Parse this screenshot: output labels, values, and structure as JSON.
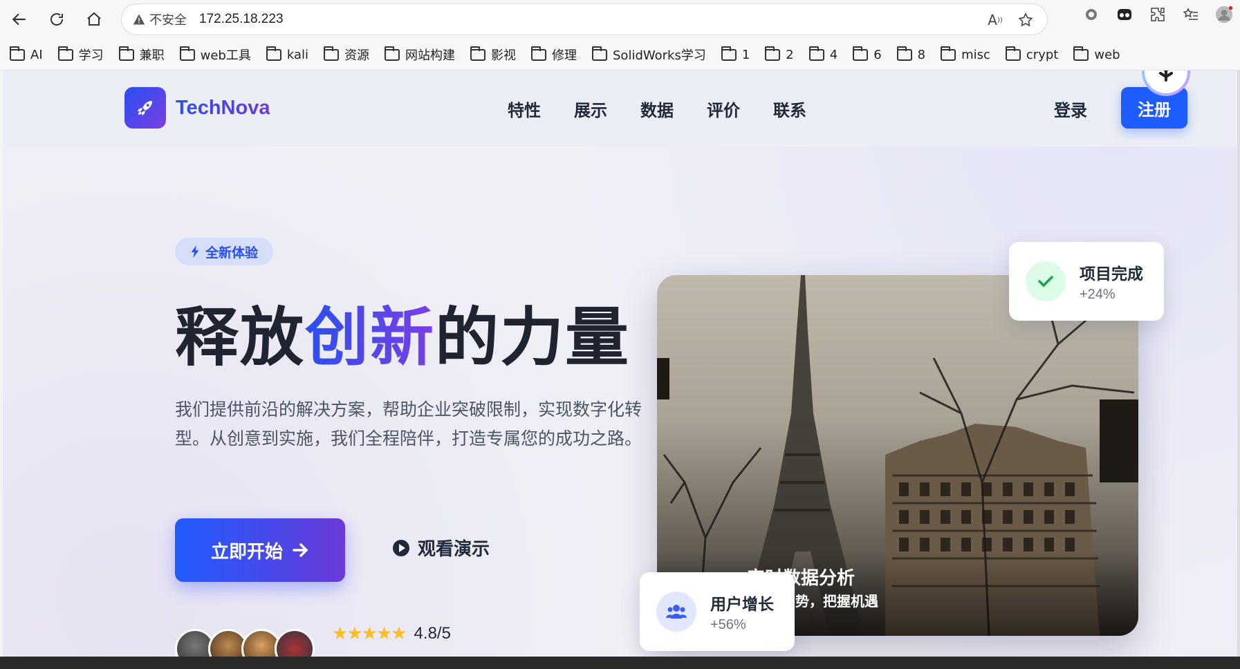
{
  "browser": {
    "security_label": "不安全",
    "url": "172.25.18.223",
    "bookmarks": [
      "AI",
      "学习",
      "兼职",
      "web工具",
      "kali",
      "资源",
      "网站构建",
      "影视",
      "修理",
      "SolidWorks学习",
      "1",
      "2",
      "4",
      "6",
      "8",
      "misc",
      "crypt",
      "web"
    ]
  },
  "nav": {
    "brand": "TechNova",
    "menu": [
      "特性",
      "展示",
      "数据",
      "评价",
      "联系"
    ],
    "login": "登录",
    "signup": "注册"
  },
  "hero": {
    "badge": "全新体验",
    "title_pre": "释放",
    "title_hl": "创新",
    "title_post": "的力量",
    "description": "我们提供前沿的解决方案，帮助企业突破限制，实现数字化转型。从创意到实施，我们全程陪伴，打造专属您的成功之路。",
    "primary_button": "立即开始",
    "secondary_button": "观看演示",
    "rating": "4.8/5",
    "image_caption_title": "实时数据分析",
    "image_caption_sub": "势，把握机遇"
  },
  "cards": {
    "project": {
      "title": "项目完成",
      "value": "+24%"
    },
    "users": {
      "title": "用户增长",
      "value": "+56%"
    }
  },
  "colors": {
    "accent": "#1f5cff",
    "accent_purple": "#7b3fe4",
    "success": "#22c55e"
  }
}
